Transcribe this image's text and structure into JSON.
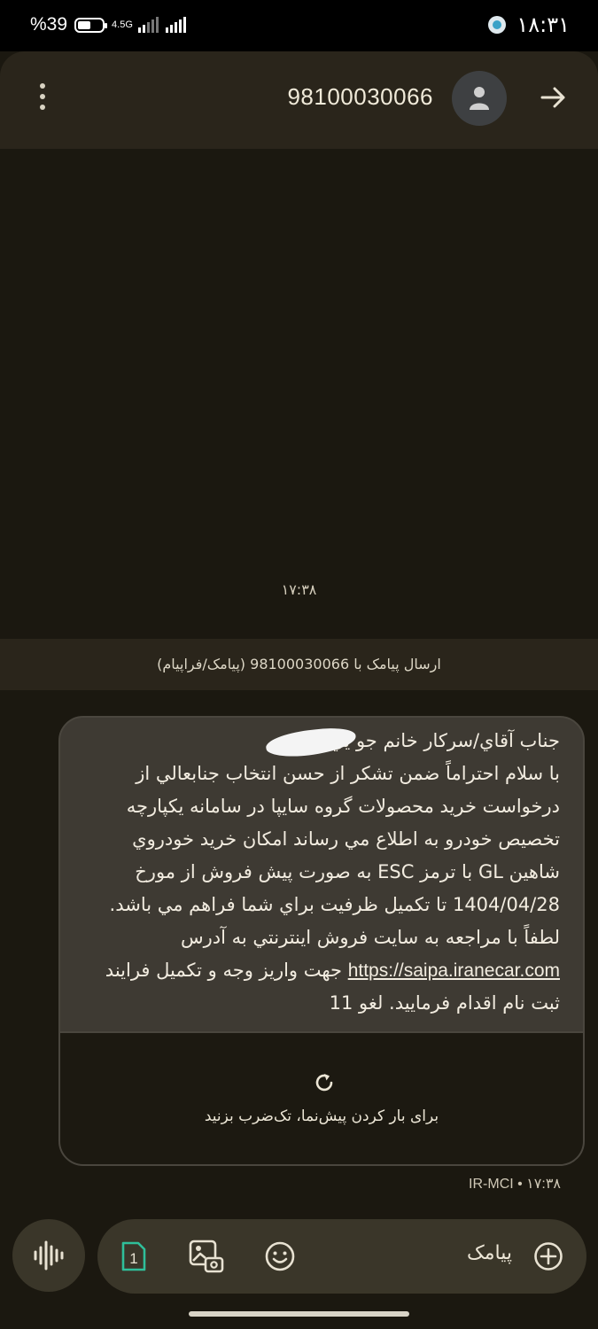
{
  "status_bar": {
    "battery_percent": "%39",
    "battery_level": 0.55,
    "network_type": "4.5G",
    "time": "۱۸:۳۱"
  },
  "header": {
    "contact_number": "98100030066",
    "icons": [
      "more-vert-icon",
      "avatar-person-icon",
      "forward-arrow-icon"
    ]
  },
  "conversation": {
    "message_time": "۱۷:۳۸",
    "sender_banner": "ارسال پیامک با 98100030066 (پیامک/فراپیام)",
    "message": {
      "text_before_link": "جناب آقاي/سركار خانم جو        يي\nبا سلام احتراماً ضمن تشكر از حسن انتخاب جنابعالي از درخواست خريد محصولات گروه سايپا در سامانه يكپارچه تخصيص خودرو به اطلاع مي رساند امكان خريد خودروي شاهين GL با ترمز ESC  به صورت پيش فروش از مورخ 1404/04/28 تا تكميل ظرفيت براي شما فراهم مي باشد. لطفاً با مراجعه به سايت فروش اينترنتي  به آدرس ",
      "link": "https://saipa.iranecar.com",
      "text_after_link": "  جهت واريز وجه و تكميل فرايند ثبت نام اقدام فرماييد. لغو 11"
    },
    "preview": {
      "label": "برای بار کردن پیش‌نما، تک‌ضرب بزنید"
    },
    "meta": "IR-MCI • ۱۷:۳۸"
  },
  "composer": {
    "placeholder": "پیامک",
    "sim_label": "1",
    "icons": [
      "voice-icon",
      "sim-icon",
      "gallery-icon",
      "emoji-icon",
      "add-icon"
    ]
  }
}
